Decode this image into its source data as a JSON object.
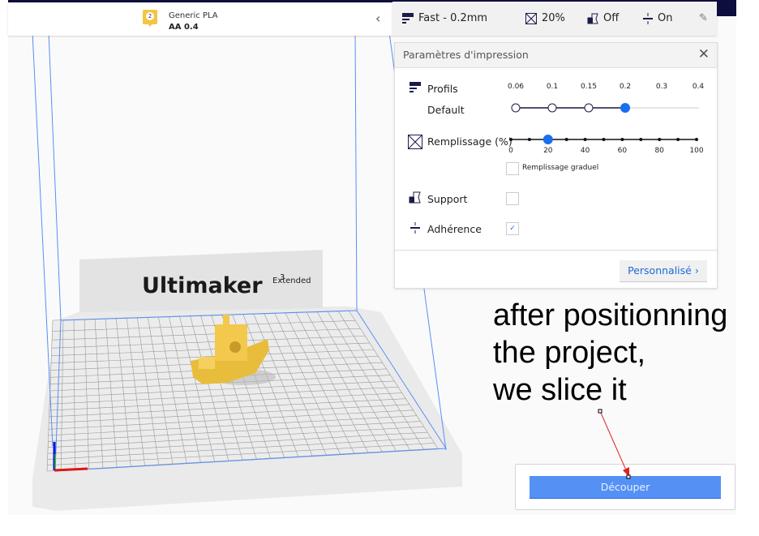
{
  "printer": {
    "extruder_number": "2",
    "material": "Generic PLA",
    "nozzle": "AA 0.4",
    "collapse_icon": "chevron-left-icon"
  },
  "settings_bar": {
    "profile": "Fast - 0.2mm",
    "infill": "20%",
    "support": "Off",
    "adhesion": "On",
    "edit_icon": "pencil-icon"
  },
  "panel": {
    "title": "Paramètres d'impression",
    "profiles_label": "Profils",
    "profile_name": "Default",
    "layer_heights": [
      "0.06",
      "0.1",
      "0.15",
      "0.2",
      "0.3",
      "0.4"
    ],
    "selected_layer_height": "0.2",
    "infill_label": "Remplissage (%)",
    "infill_ticks": [
      "0",
      "20",
      "40",
      "60",
      "80",
      "100"
    ],
    "infill_value": 20,
    "gradual_infill_label": "Remplissage graduel",
    "gradual_infill_checked": false,
    "support_label": "Support",
    "support_checked": false,
    "adhesion_label": "Adhérence",
    "adhesion_checked": true,
    "custom_button": "Personnalisé"
  },
  "scene": {
    "brand": "Ultimaker",
    "model_sup": "3",
    "model_sub": "Extended",
    "object_color": "#f2c94c"
  },
  "annotation": {
    "line1": "after positionning",
    "line2": "the project,",
    "line3": "we slice it",
    "arrow_color": "#e0201b"
  },
  "slice_button": "Découper",
  "colors": {
    "accent": "#196ef0",
    "button": "#5591f5",
    "topbar": "#0e0e3d"
  }
}
